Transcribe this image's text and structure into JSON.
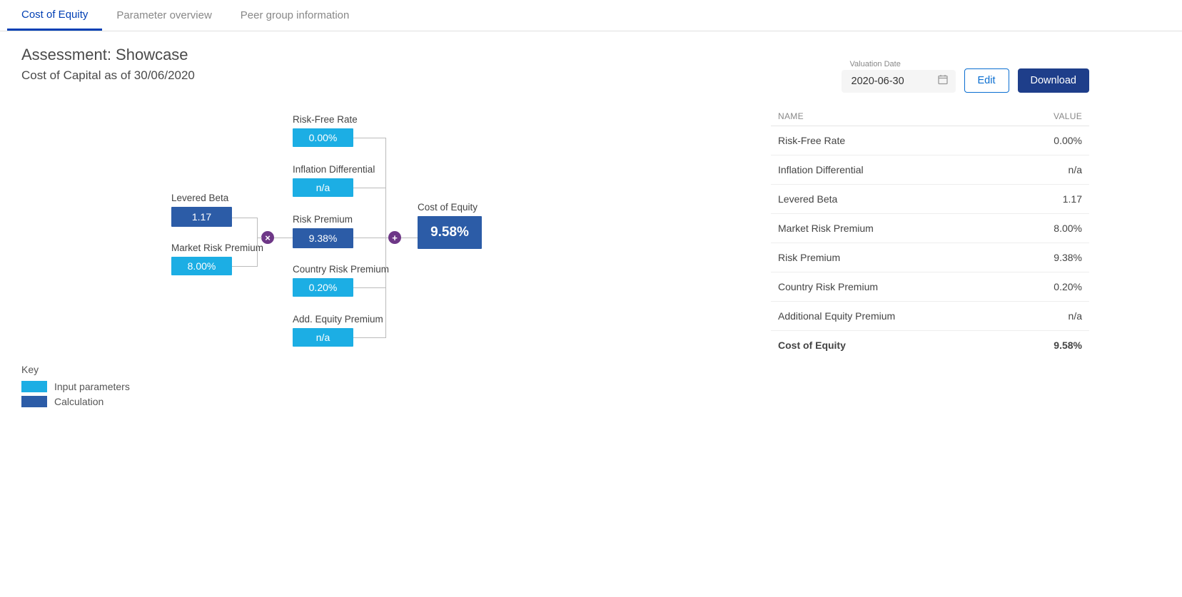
{
  "tabs": {
    "items": [
      {
        "label": "Cost of Equity",
        "active": true
      },
      {
        "label": "Parameter overview",
        "active": false
      },
      {
        "label": "Peer group information",
        "active": false
      }
    ]
  },
  "header": {
    "title": "Assessment: Showcase",
    "subtitle": "Cost of Capital as of 30/06/2020",
    "date_label": "Valuation Date",
    "date_value": "2020-06-30",
    "edit_label": "Edit",
    "download_label": "Download"
  },
  "diagram": {
    "levered_beta": {
      "label": "Levered Beta",
      "value": "1.17",
      "kind": "calc"
    },
    "market_risk_premium": {
      "label": "Market Risk Premium",
      "value": "8.00%",
      "kind": "input"
    },
    "risk_free_rate": {
      "label": "Risk-Free Rate",
      "value": "0.00%",
      "kind": "input"
    },
    "inflation_diff": {
      "label": "Inflation Differential",
      "value": "n/a",
      "kind": "input"
    },
    "risk_premium": {
      "label": "Risk Premium",
      "value": "9.38%",
      "kind": "calc"
    },
    "country_risk": {
      "label": "Country Risk Premium",
      "value": "0.20%",
      "kind": "input"
    },
    "add_equity": {
      "label": "Add. Equity Premium",
      "value": "n/a",
      "kind": "input"
    },
    "cost_of_equity": {
      "label": "Cost of Equity",
      "value": "9.58%",
      "kind": "result"
    },
    "op_multiply": "×",
    "op_plus": "+"
  },
  "legend": {
    "title": "Key",
    "input_label": "Input parameters",
    "calc_label": "Calculation"
  },
  "table": {
    "col_name": "NAME",
    "col_value": "VALUE",
    "rows": [
      {
        "name": "Risk-Free Rate",
        "value": "0.00%"
      },
      {
        "name": "Inflation Differential",
        "value": "n/a"
      },
      {
        "name": "Levered Beta",
        "value": "1.17"
      },
      {
        "name": "Market Risk Premium",
        "value": "8.00%"
      },
      {
        "name": "Risk Premium",
        "value": "9.38%"
      },
      {
        "name": "Country Risk Premium",
        "value": "0.20%"
      },
      {
        "name": "Additional Equity Premium",
        "value": "n/a"
      }
    ],
    "total": {
      "name": "Cost of Equity",
      "value": "9.58%"
    }
  }
}
